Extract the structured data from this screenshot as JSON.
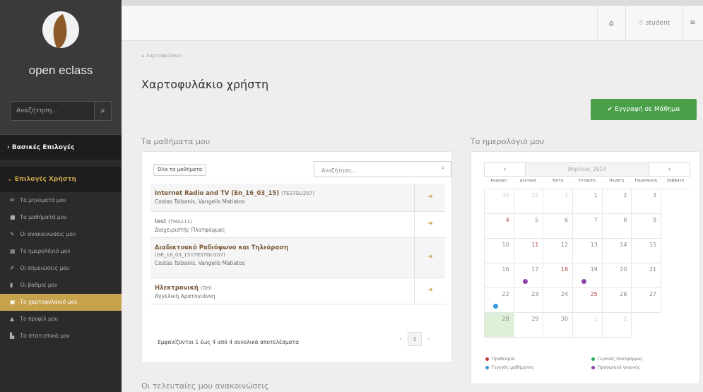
{
  "sidebar": {
    "logo_text": "open eclass",
    "search_placeholder": "Αναζήτηση...",
    "section_basic": "Βασικές Επιλογές",
    "section_user": "Επιλογές Χρήστη",
    "items": [
      {
        "label": "Τα μηνύματά μου",
        "icon": "envelope-icon",
        "glyph": "✉"
      },
      {
        "label": "Τα μαθήματά μου",
        "icon": "book-icon",
        "glyph": "■"
      },
      {
        "label": "Οι ανακοινώσεις μου",
        "icon": "bullhorn-icon",
        "glyph": "✎"
      },
      {
        "label": "Το ημερολόγιό μου",
        "icon": "calendar-icon",
        "glyph": "▦"
      },
      {
        "label": "Οι σημειώσεις μου",
        "icon": "notes-icon",
        "glyph": "✐"
      },
      {
        "label": "Οι βαθμοί μου",
        "icon": "grades-icon",
        "glyph": "▮"
      },
      {
        "label": "Το χαρτοφυλάκιό μου",
        "icon": "portfolio-icon",
        "glyph": "▣"
      },
      {
        "label": "Το προφίλ μου",
        "icon": "user-icon",
        "glyph": "▲"
      },
      {
        "label": "Τα στατιστικά μου",
        "icon": "stats-icon",
        "glyph": "▙"
      }
    ],
    "active_index": 6
  },
  "topbar": {
    "home_icon": "home-icon",
    "user_label": "student",
    "menu_icon": "menu-icon"
  },
  "breadcrumb": "Χαρτοφυλάκιο",
  "page_title": "Χαρτοφυλάκιο χρήστη",
  "register_button": "✔ Εγγραφή σε Μάθημα",
  "courses": {
    "heading": "Τα μαθήματα μου",
    "all_button": "Όλα τα μαθήματα",
    "search_placeholder": "Αναζήτηση...",
    "rows": [
      {
        "name": "Internet Radio and TV (En_16_03_15)",
        "code": "(TESTGU207)",
        "prof": "Costas Tsibanis, Vangelis Matiatos",
        "bold": true
      },
      {
        "name": "test",
        "code": "(TMA111)",
        "prof": "Διαχειριστής Πλατφόρμας",
        "bold": false
      },
      {
        "name": "Διαδικτυακό Ραδιόφωνο και Τηλεόραση",
        "name2": "(GR_16_03_15)",
        "code": "(TESTGU207)",
        "prof": "Costas Tsibanis, Vangelis Matiatos",
        "bold": true
      },
      {
        "name": "Ηλεκτρονική",
        "code": "(DH)",
        "prof": "Αγγελική Αρατογιάννη",
        "bold": true
      }
    ],
    "footer": "Εμφανίζονται 1 έως 4 από 4 συνολικά αποτελέσματα",
    "pagination": {
      "prev": "‹",
      "current": "1",
      "next": "›"
    }
  },
  "calendar": {
    "heading": "Το ημερολόγιό μου",
    "month_label": "Απρίλιος 2014",
    "prev": "‹",
    "next": "›",
    "weekdays": [
      "Κυριακή",
      "Δευτέρα",
      "Τρίτη",
      "Τετάρτη",
      "Πέμπτη",
      "Παρασκευή",
      "Σάββατο"
    ],
    "weeks": [
      [
        "30",
        "31",
        "1",
        "1",
        "2",
        "3",
        "4"
      ],
      [
        "5",
        "6",
        "7",
        "8",
        "9",
        "10",
        "11"
      ],
      [
        "12",
        "13",
        "14",
        "15",
        "16",
        "17",
        "18"
      ],
      [
        "19",
        "20",
        "21",
        "22",
        "23",
        "24",
        "25"
      ],
      [
        "26",
        "27",
        "28",
        "29",
        "30",
        "1",
        "2"
      ]
    ],
    "legend": [
      {
        "label": "Προθεσμία",
        "color": "#c0392b"
      },
      {
        "label": "Γεγονός μαθήματος",
        "color": "#3498db"
      },
      {
        "label": "Γεγονός πλατφόρμας",
        "color": "#27ae60"
      },
      {
        "label": "Προσωπικό γεγονός",
        "color": "#8e44ad"
      }
    ],
    "events": [
      {
        "week": 2,
        "day": 5,
        "color": "#8e44ad"
      },
      {
        "week": 3,
        "day": 0,
        "color": "#8e44ad"
      },
      {
        "week": 3,
        "day": 3,
        "color": "#3498db"
      }
    ]
  },
  "announcements_heading": "Οι τελευταίες μου ανακοινώσεις",
  "colors": {
    "accent": "#c7a24d",
    "primary_button": "#49a049",
    "sidebar_bg": "#2b2b2b"
  }
}
